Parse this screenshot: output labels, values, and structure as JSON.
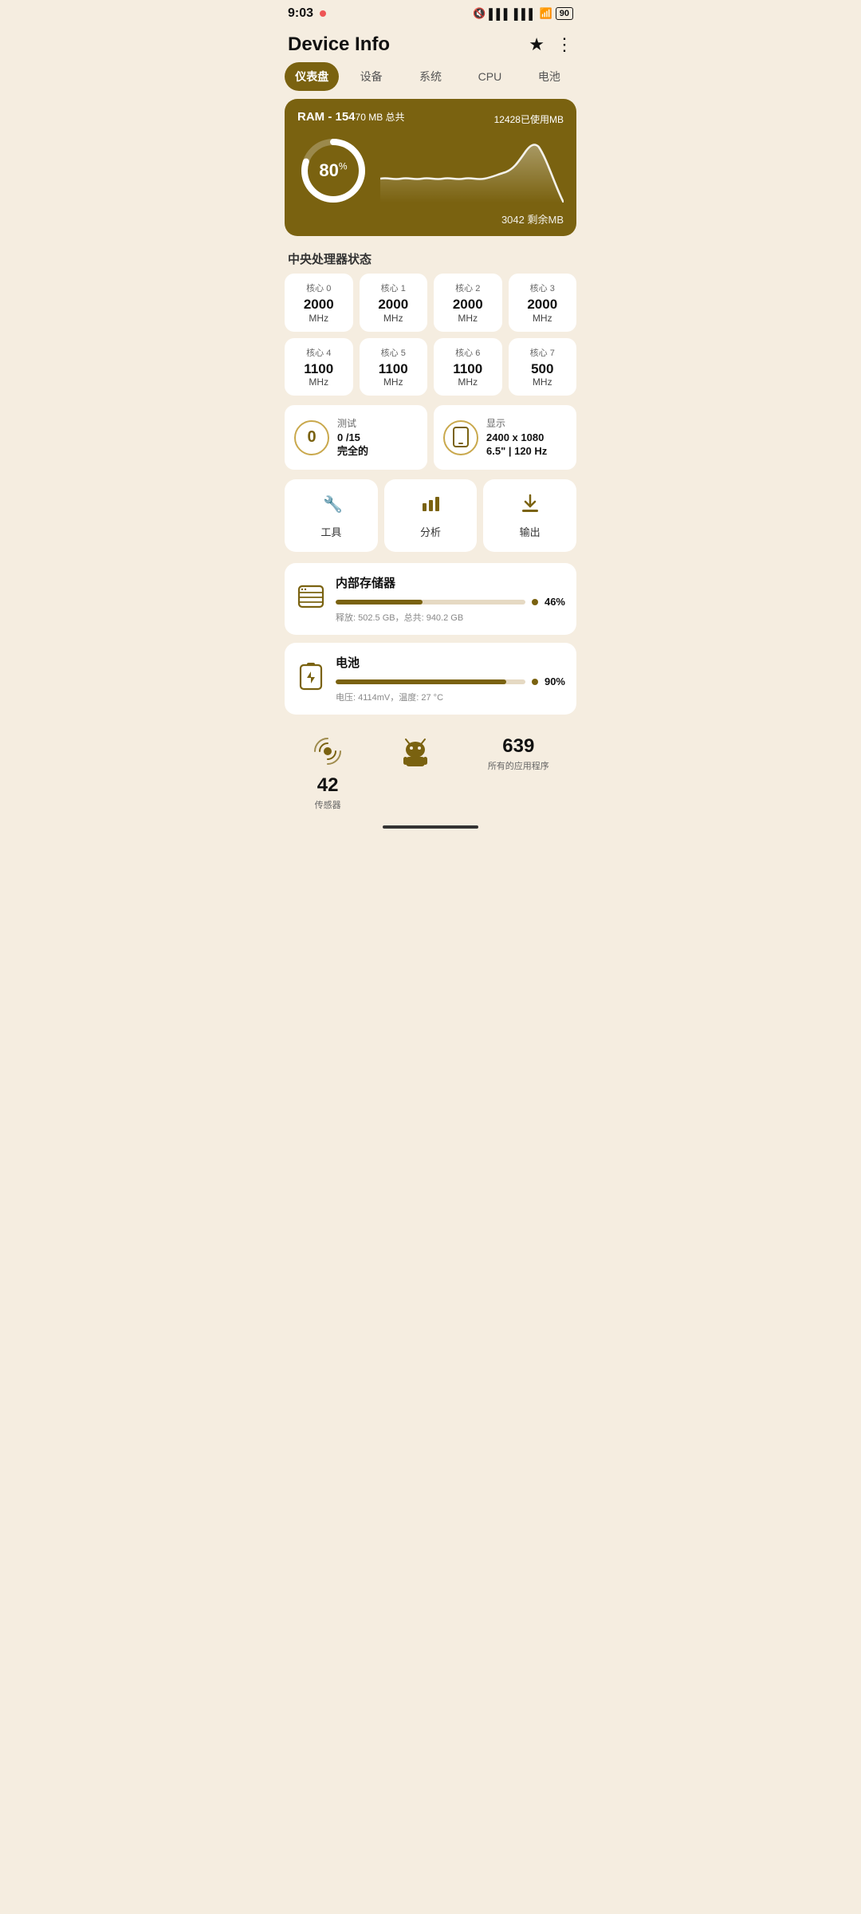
{
  "statusBar": {
    "time": "9:03",
    "battery": "90"
  },
  "header": {
    "title": "Device Info"
  },
  "tabs": [
    {
      "label": "仪表盘",
      "active": true
    },
    {
      "label": "设备",
      "active": false
    },
    {
      "label": "系统",
      "active": false
    },
    {
      "label": "CPU",
      "active": false
    },
    {
      "label": "电池",
      "active": false
    }
  ],
  "ram": {
    "title": "RAM - 154",
    "title_suffix": "70 MB 总共",
    "used_label": "已使用MB",
    "used_value": "12428",
    "percent": "80",
    "percent_suffix": "%",
    "remaining_value": "3042",
    "remaining_label": "剩余MB"
  },
  "cpuSection": {
    "title": "中央处理器状态",
    "cores": [
      {
        "name": "核心 0",
        "freq": "2000",
        "unit": "MHz"
      },
      {
        "name": "核心 1",
        "freq": "2000",
        "unit": "MHz"
      },
      {
        "name": "核心 2",
        "freq": "2000",
        "unit": "MHz"
      },
      {
        "name": "核心 3",
        "freq": "2000",
        "unit": "MHz"
      },
      {
        "name": "核心 4",
        "freq": "1100",
        "unit": "MHz"
      },
      {
        "name": "核心 5",
        "freq": "1100",
        "unit": "MHz"
      },
      {
        "name": "核心 6",
        "freq": "1100",
        "unit": "MHz"
      },
      {
        "name": "核心 7",
        "freq": "500",
        "unit": "MHz"
      }
    ]
  },
  "infoCards": [
    {
      "label": "测试",
      "value": "0 /15",
      "value2": "完全的",
      "icon": "0"
    },
    {
      "label": "显示",
      "value": "2400 x 1080",
      "value2": "6.5\" | 120 Hz"
    }
  ],
  "actions": [
    {
      "label": "工具",
      "icon": "🔧"
    },
    {
      "label": "分析",
      "icon": "📊"
    },
    {
      "label": "输出",
      "icon": "📥"
    }
  ],
  "storage": {
    "title": "内部存储器",
    "percent": 46,
    "percent_label": "46%",
    "sub": "释放: 502.5 GB，总共: 940.2 GB"
  },
  "battery": {
    "title": "电池",
    "percent": 90,
    "percent_label": "90%",
    "sub": "电压: 4114mV，温度: 27 °C"
  },
  "bottomStats": [
    {
      "number": "42",
      "label": "传感器"
    },
    {
      "number": "639",
      "label": "所有的应用程序"
    }
  ]
}
